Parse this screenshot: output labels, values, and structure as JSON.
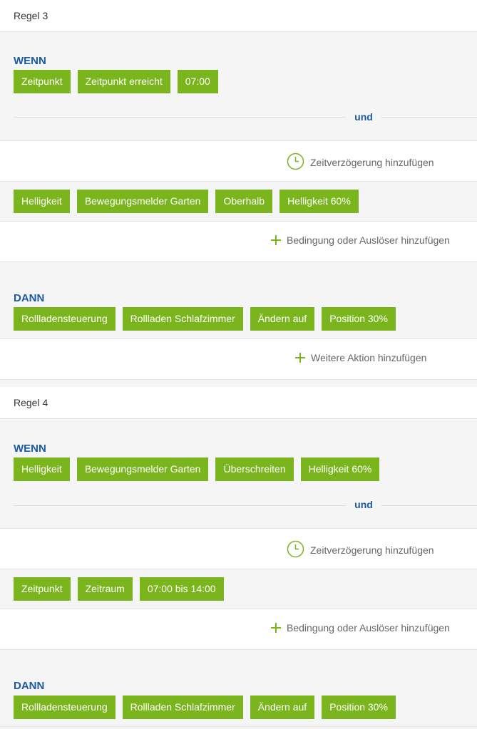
{
  "rules": [
    {
      "title": "Regel 3",
      "if_label": "WENN",
      "trigger_chips": [
        "Zeitpunkt",
        "Zeitpunkt erreicht",
        "07:00"
      ],
      "and_label": "und",
      "delay_label": "Zeitverzögerung hinzufügen",
      "condition_chips": [
        "Helligkeit",
        "Bewegungsmelder Garten",
        "Oberhalb",
        "Helligkeit 60%"
      ],
      "add_condition_label": "Bedingung oder Auslöser hinzufügen",
      "then_label": "DANN",
      "action_chips": [
        "Rollladensteuerung",
        "Rollladen Schlafzimmer",
        "Ändern auf",
        "Position 30%"
      ],
      "add_action_label": "Weitere Aktion hinzufügen"
    },
    {
      "title": "Regel 4",
      "if_label": "WENN",
      "trigger_chips": [
        "Helligkeit",
        "Bewegungsmelder Garten",
        "Überschreiten",
        "Helligkeit 60%"
      ],
      "and_label": "und",
      "delay_label": "Zeitverzögerung hinzufügen",
      "condition_chips": [
        "Zeitpunkt",
        "Zeitraum",
        "07:00 bis 14:00"
      ],
      "add_condition_label": "Bedingung oder Auslöser hinzufügen",
      "then_label": "DANN",
      "action_chips": [
        "Rollladensteuerung",
        "Rollladen Schlafzimmer",
        "Ändern auf",
        "Position 30%"
      ]
    }
  ],
  "icons": {
    "delay": "clock-icon",
    "add": "plus-icon"
  },
  "colors": {
    "chip": "#7ab51d",
    "section_label": "#1a5aa0",
    "background": "#f5f5f5"
  }
}
